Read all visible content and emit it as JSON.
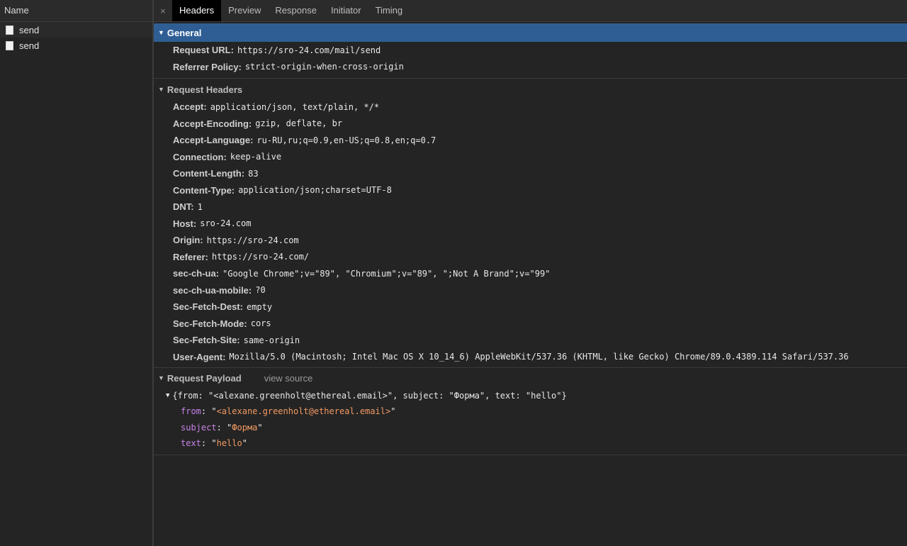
{
  "left_panel": {
    "header": "Name",
    "requests": [
      "send",
      "send"
    ]
  },
  "tabs": {
    "close": "×",
    "items": [
      "Headers",
      "Preview",
      "Response",
      "Initiator",
      "Timing"
    ],
    "active": "Headers"
  },
  "general": {
    "title": "General",
    "rows": [
      {
        "key": "Request URL:",
        "value": "https://sro-24.com/mail/send"
      },
      {
        "key": "Referrer Policy:",
        "value": "strict-origin-when-cross-origin"
      }
    ]
  },
  "request_headers": {
    "title": "Request Headers",
    "rows": [
      {
        "key": "Accept:",
        "value": "application/json, text/plain, */*"
      },
      {
        "key": "Accept-Encoding:",
        "value": "gzip, deflate, br"
      },
      {
        "key": "Accept-Language:",
        "value": "ru-RU,ru;q=0.9,en-US;q=0.8,en;q=0.7"
      },
      {
        "key": "Connection:",
        "value": "keep-alive"
      },
      {
        "key": "Content-Length:",
        "value": "83"
      },
      {
        "key": "Content-Type:",
        "value": "application/json;charset=UTF-8"
      },
      {
        "key": "DNT:",
        "value": "1"
      },
      {
        "key": "Host:",
        "value": "sro-24.com"
      },
      {
        "key": "Origin:",
        "value": "https://sro-24.com"
      },
      {
        "key": "Referer:",
        "value": "https://sro-24.com/"
      },
      {
        "key": "sec-ch-ua:",
        "value": "\"Google Chrome\";v=\"89\", \"Chromium\";v=\"89\", \";Not A Brand\";v=\"99\""
      },
      {
        "key": "sec-ch-ua-mobile:",
        "value": "?0"
      },
      {
        "key": "Sec-Fetch-Dest:",
        "value": "empty"
      },
      {
        "key": "Sec-Fetch-Mode:",
        "value": "cors"
      },
      {
        "key": "Sec-Fetch-Site:",
        "value": "same-origin"
      },
      {
        "key": "User-Agent:",
        "value": "Mozilla/5.0 (Macintosh; Intel Mac OS X 10_14_6) AppleWebKit/537.36 (KHTML, like Gecko) Chrome/89.0.4389.114 Safari/537.36"
      }
    ]
  },
  "payload": {
    "title": "Request Payload",
    "view_source": "view source",
    "summary": "{from: \"<alexane.greenholt@ethereal.email>\", subject: \"Форма\", text: \"hello\"}",
    "fields": [
      {
        "key": "from",
        "value": "<alexane.greenholt@ethereal.email>"
      },
      {
        "key": "subject",
        "value": "Форма"
      },
      {
        "key": "text",
        "value": "hello"
      }
    ]
  },
  "icons": {
    "section_toggle": "triangle-down-icon",
    "request_file": "document-icon",
    "close": "close-icon"
  },
  "colors": {
    "selected_section": "#2f5e94",
    "payload_key": "#c882e8",
    "payload_string": "#f29a63"
  }
}
